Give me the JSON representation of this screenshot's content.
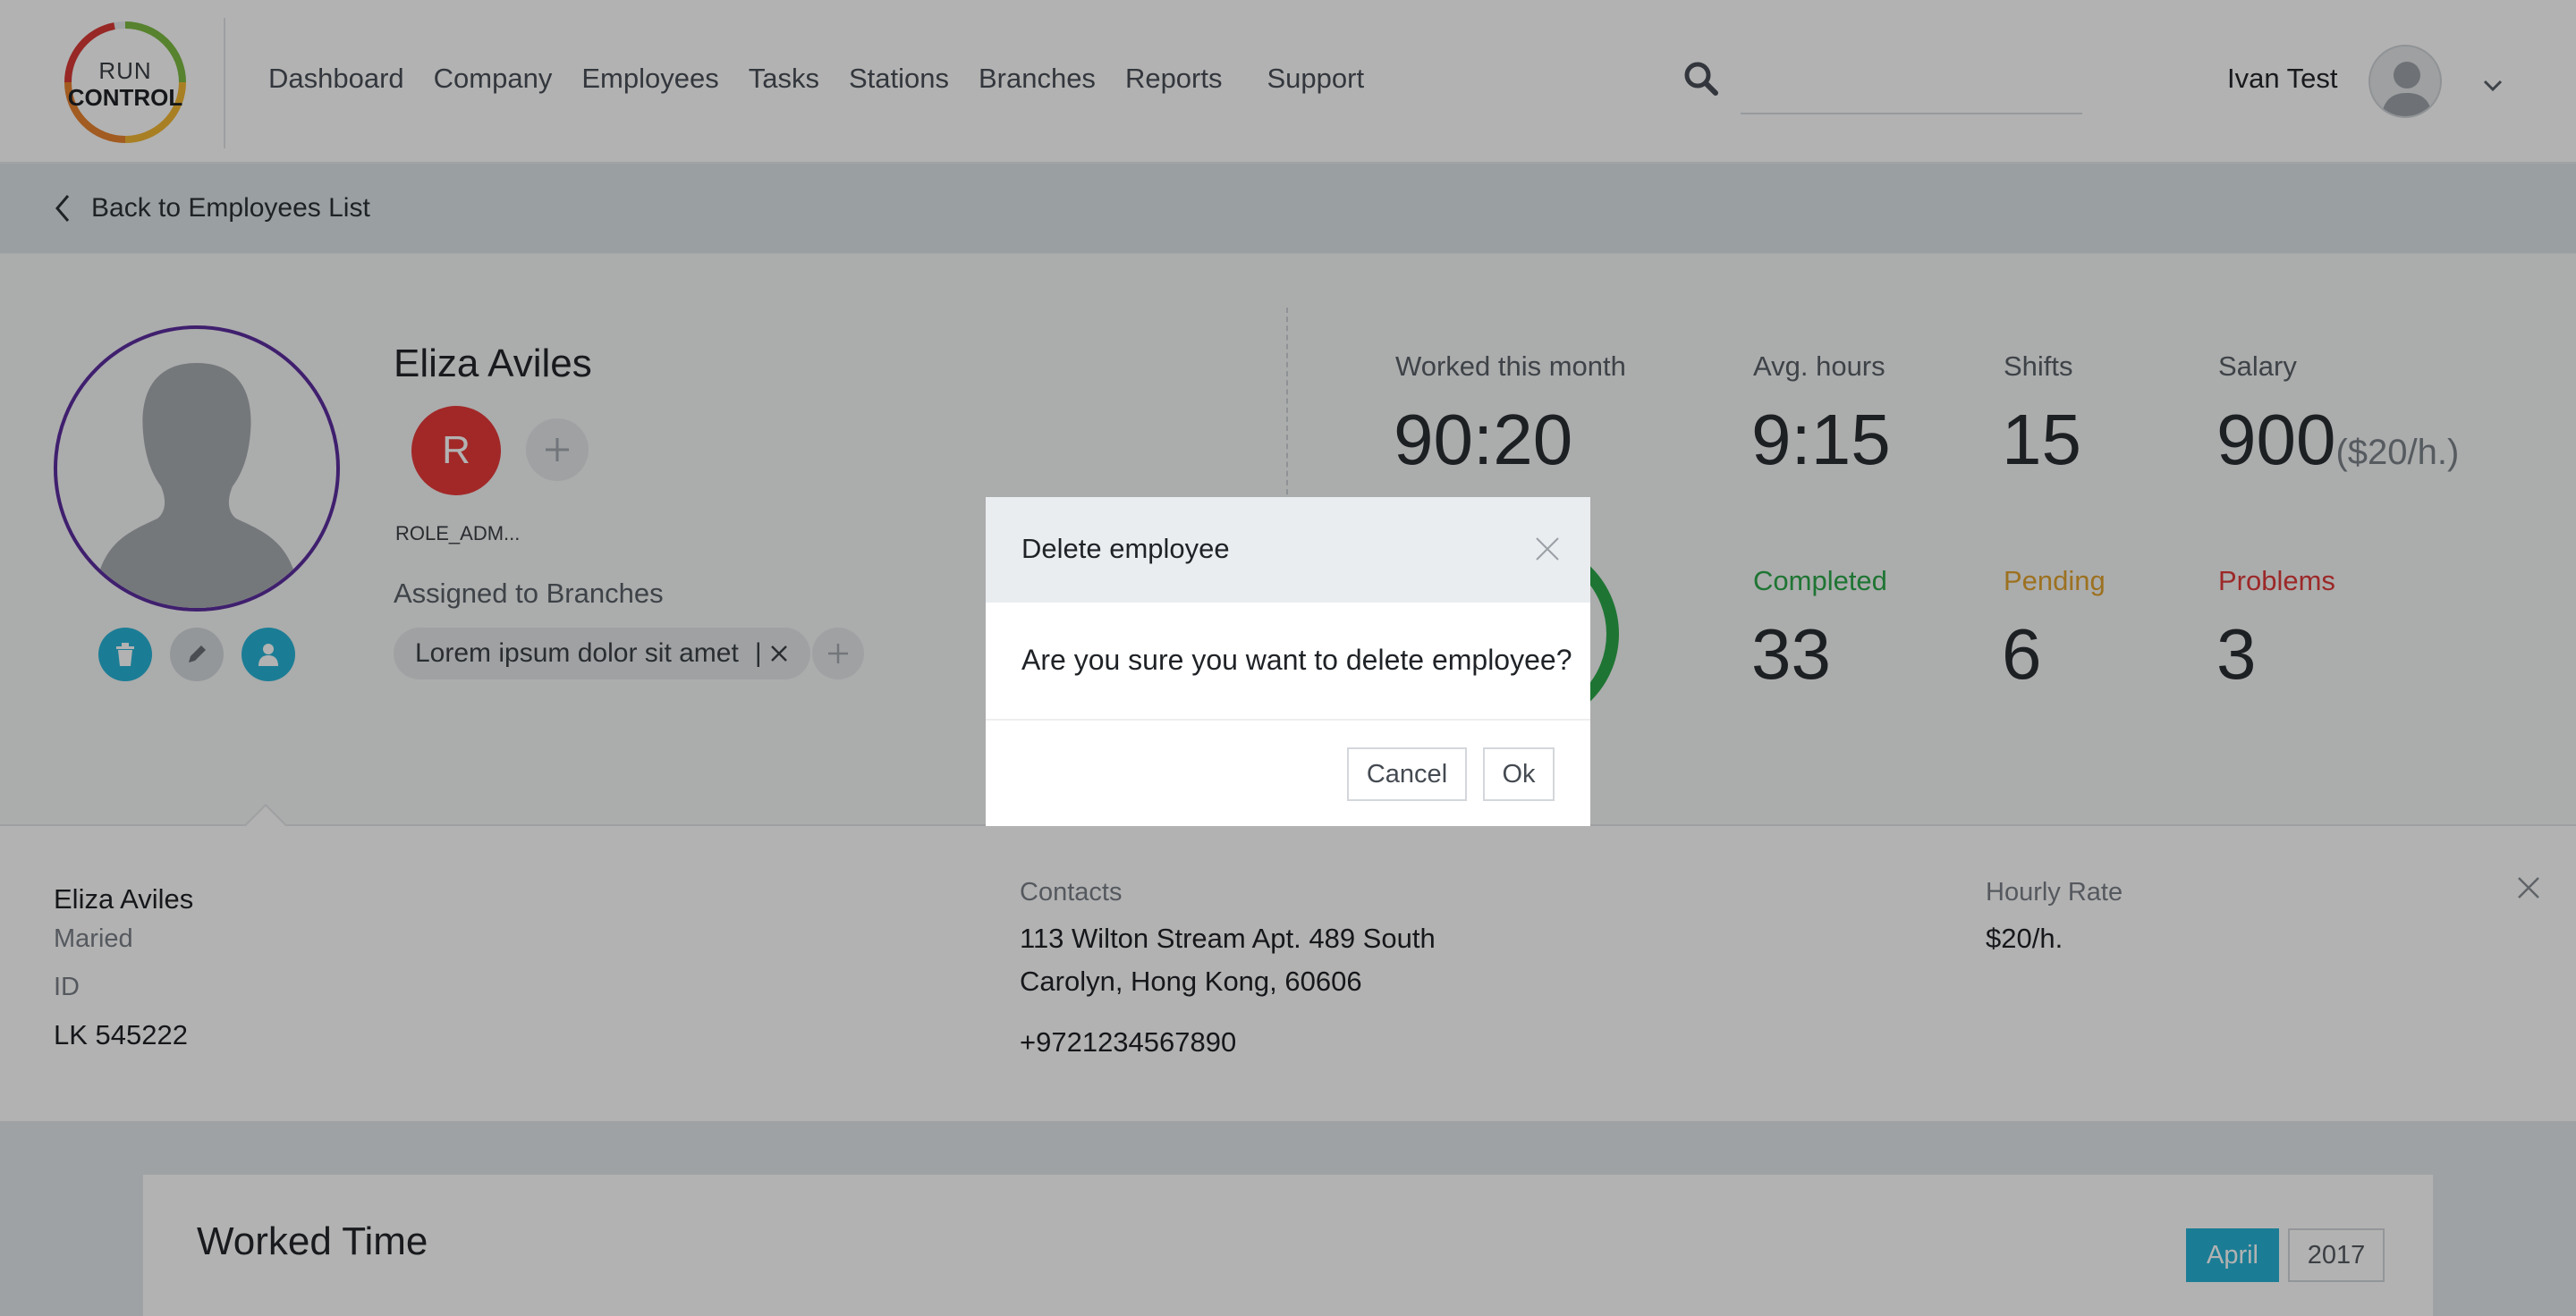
{
  "app": {
    "logo_run": "RUN",
    "logo_control": "CONTROL"
  },
  "nav": {
    "items": [
      "Dashboard",
      "Company",
      "Employees",
      "Tasks",
      "Stations",
      "Branches",
      "Reports",
      "Support"
    ]
  },
  "search": {
    "value": "",
    "placeholder": ""
  },
  "user": {
    "name": "Ivan Test"
  },
  "back": {
    "label": "Back to Employees List"
  },
  "employee": {
    "name": "Eliza Aviles",
    "role_initial": "R",
    "role_label": "ROLE_ADM...",
    "assigned_label": "Assigned to Branches",
    "branches": [
      "Lorem ipsum dolor sit amet"
    ],
    "branch_separator": "|"
  },
  "stats": {
    "worked_label": "Worked this month",
    "worked_value": "90:20",
    "avg_label": "Avg. hours",
    "avg_value": "9:15",
    "shifts_label": "Shifts",
    "shifts_value": "15",
    "salary_label": "Salary",
    "salary_value": "900",
    "salary_rate": "($20/h.)",
    "completed_label": "Completed",
    "completed_value": "33",
    "pending_label": "Pending",
    "pending_value": "6",
    "problems_label": "Problems",
    "problems_value": "3"
  },
  "colors": {
    "accent": "#27b3d6",
    "role": "#e83a3a",
    "avatar_ring": "#5b2d9e",
    "completed": "#2ba84a",
    "pending": "#e0a32e",
    "problems": "#e03a3a"
  },
  "details": {
    "name": "Eliza Aviles",
    "marital": "Maried",
    "id_label": "ID",
    "id_value": "LK 545222",
    "contacts_label": "Contacts",
    "address_line1": "113 Wilton Stream Apt. 489 South",
    "address_line2": "Carolyn, Hong Kong, 60606",
    "phone": "+9721234567890",
    "rate_label": "Hourly Rate",
    "rate_value": "$20/h."
  },
  "worked_time": {
    "title": "Worked Time",
    "month": "April",
    "year": "2017"
  },
  "modal": {
    "title": "Delete employee",
    "message": "Are you sure you want to delete employee?",
    "cancel": "Cancel",
    "ok": "Ok"
  }
}
